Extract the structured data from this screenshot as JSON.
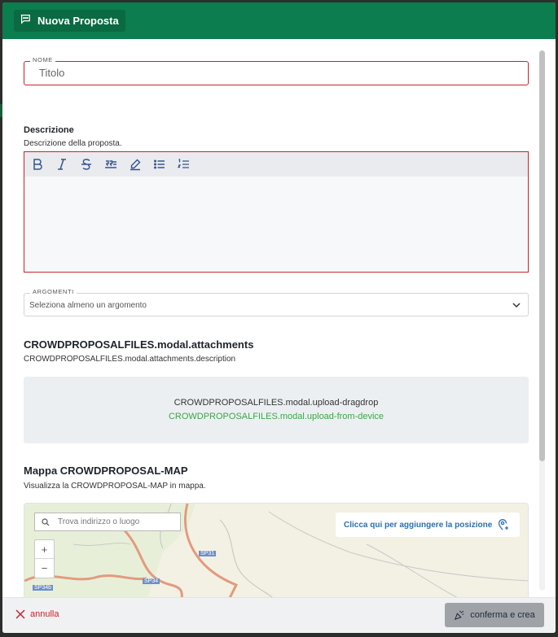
{
  "modal": {
    "title": "Nuova Proposta"
  },
  "form": {
    "name_legend": "NOME",
    "name_value": "Titolo",
    "description_title": "Descrizione",
    "description_subtitle": "Descrizione della proposta.",
    "editor_toolbar": [
      "bold-icon",
      "italic-icon",
      "strikethrough-icon",
      "quote-icon",
      "highlight-icon",
      "bullet-list-icon",
      "numbered-list-icon"
    ],
    "arguments_legend": "ARGOMENTI",
    "arguments_placeholder": "Seleziona almeno un argomento"
  },
  "attachments": {
    "title": "CROWDPROPOSALFILES.modal.attachments",
    "description": "CROWDPROPOSALFILES.modal.attachments.description",
    "upload_dragdrop": "CROWDPROPOSALFILES.modal.upload-dragdrop",
    "upload_from_device": "CROWDPROPOSALFILES.modal.upload-from-device"
  },
  "map": {
    "title": "Mappa CROWDPROPOSAL-MAP",
    "description": "Visualizza la CROWDPROPOSAL-MAP in mappa.",
    "search_placeholder": "Trova indirizzo o luogo",
    "zoom_in": "+",
    "zoom_out": "−",
    "add_position_label": "Clicca qui per aggiungere la posizione",
    "road_labels": [
      "SP31",
      "SP34",
      "SP34b"
    ]
  },
  "footer": {
    "cancel_label": "annulla",
    "confirm_label": "conferma e crea"
  },
  "colors": {
    "header": "#0b7d4f",
    "error_border": "#c8232c",
    "link_green": "#3aa745",
    "link_blue": "#2a6fb3",
    "confirm_bg": "#9fa2a7"
  }
}
